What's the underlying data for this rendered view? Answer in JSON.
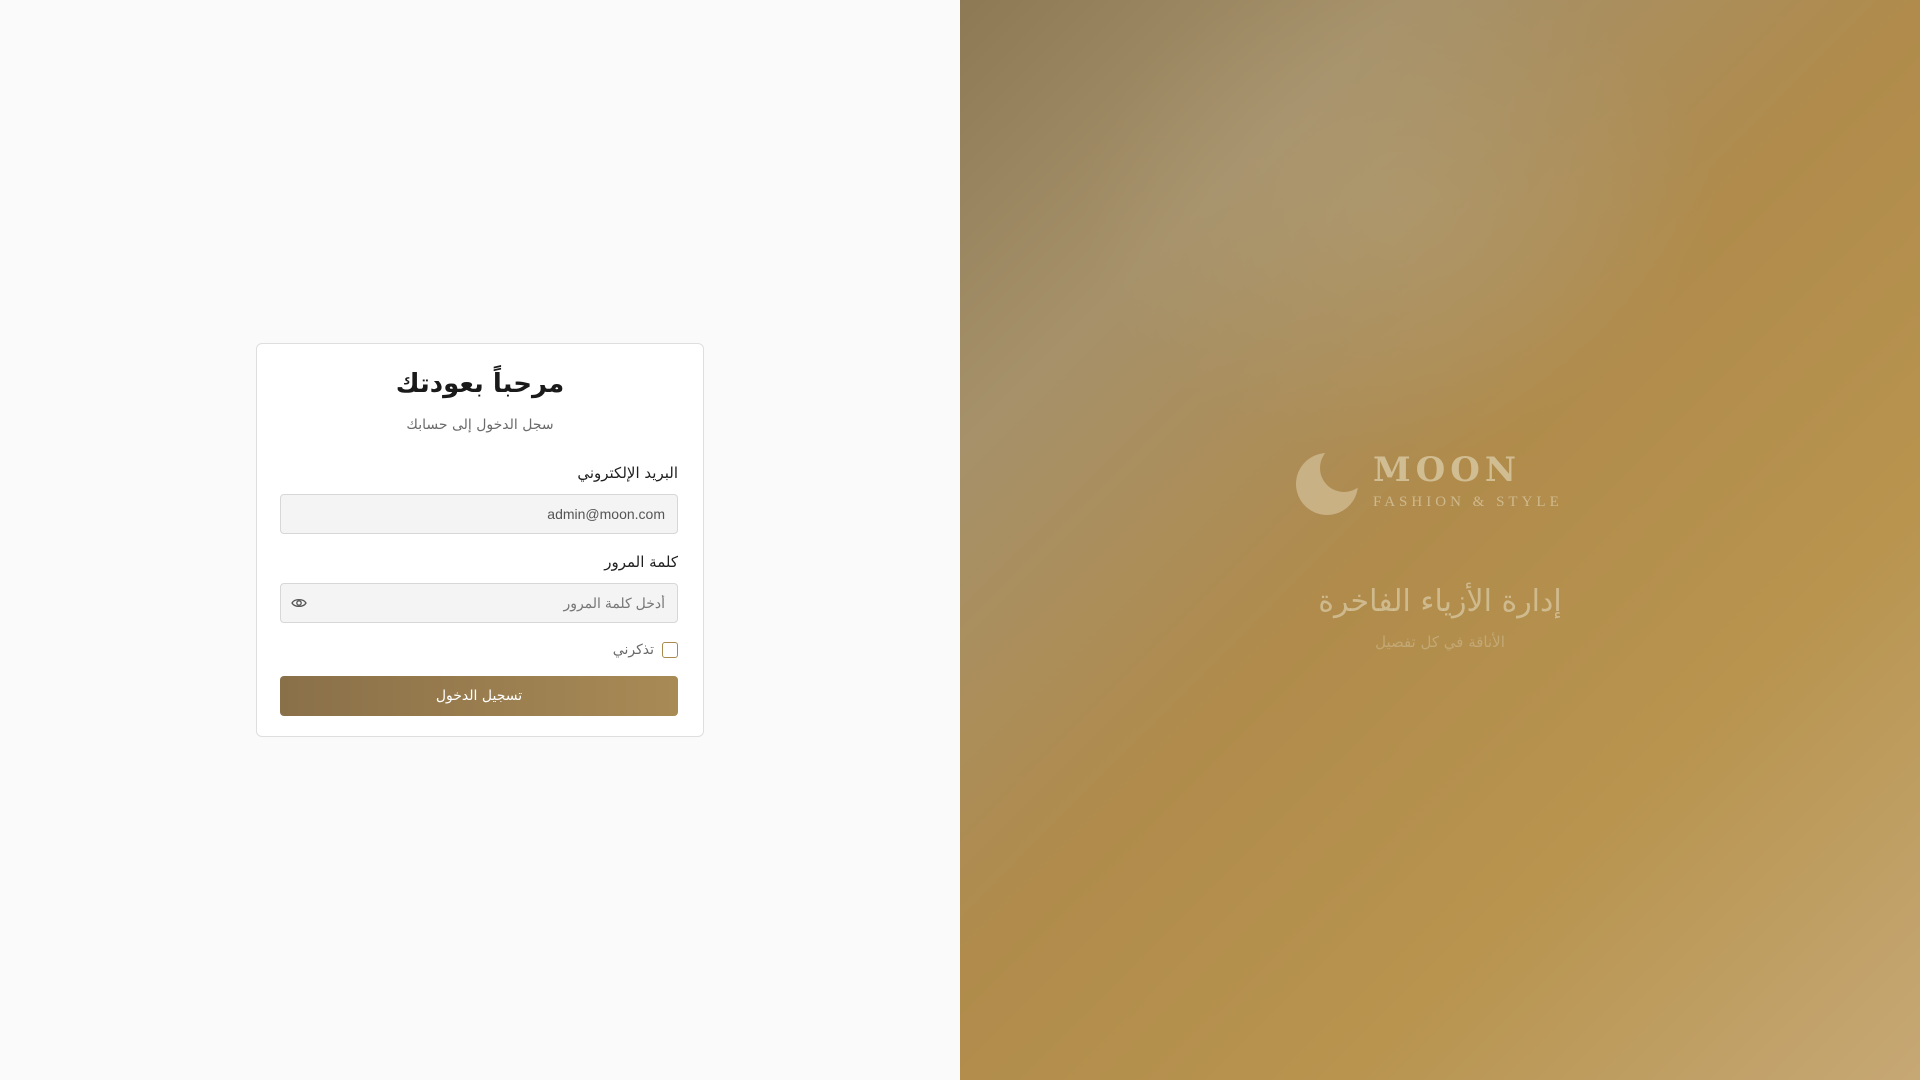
{
  "login": {
    "title": "مرحباً بعودتك",
    "subtitle": "سجل الدخول إلى حسابك",
    "email": {
      "label": "البريد الإلكتروني",
      "value": "admin@moon.com"
    },
    "password": {
      "label": "كلمة المرور",
      "placeholder": "أدخل كلمة المرور",
      "toggle_icon": "eye-icon"
    },
    "remember_label": "تذكرني",
    "submit_label": "تسجيل الدخول"
  },
  "brand": {
    "name": "MOON",
    "tagline": "FASHION & STYLE",
    "logo_icon": "crescent-moon-icon",
    "hero_title": "إدارة الأزياء الفاخرة",
    "hero_subtitle": "الأناقة في كل تفصيل"
  },
  "colors": {
    "accent": "#a88a55",
    "accent_dark": "#8a7049",
    "panel_background": "#b08b4b",
    "page_background": "#fafafa"
  }
}
